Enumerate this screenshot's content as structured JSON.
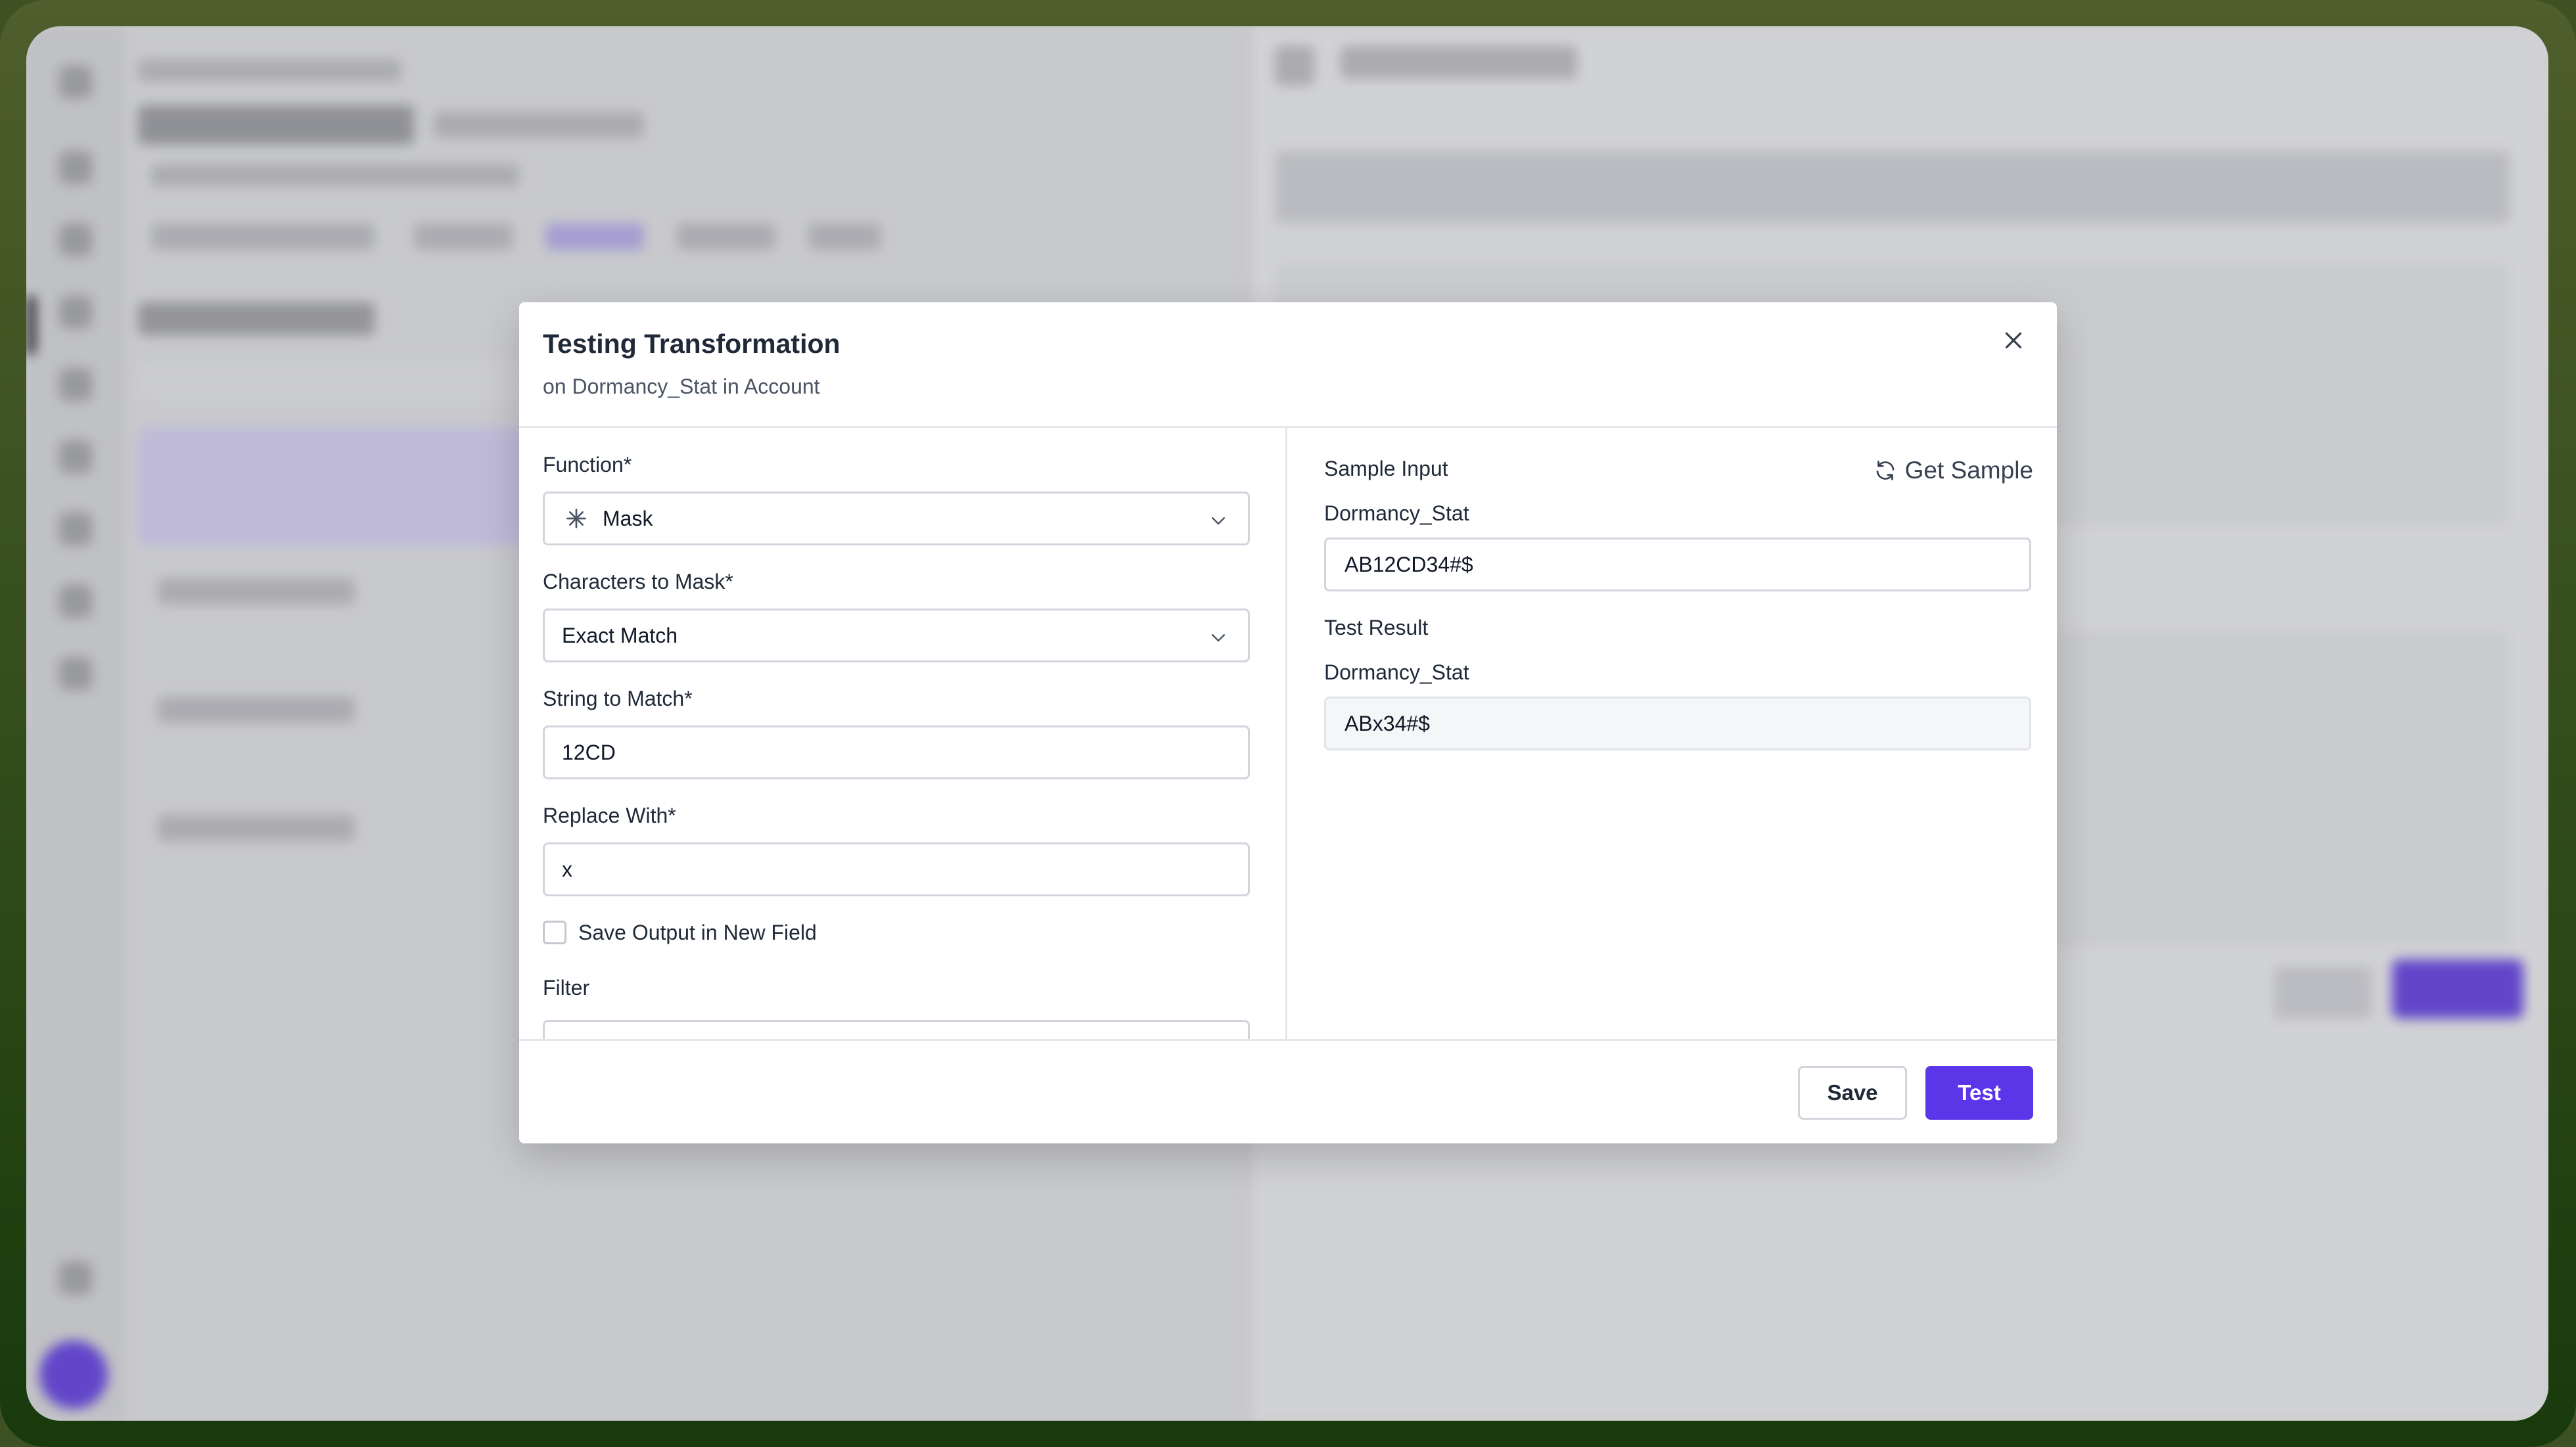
{
  "modal": {
    "title": "Testing Transformation",
    "subtitle": "on Dormancy_Stat in Account",
    "close_icon": "close-icon"
  },
  "form": {
    "function_label": "Function*",
    "function_value": "Mask",
    "function_icon": "asterisk-icon",
    "chars_label": "Characters to Mask*",
    "chars_value": "Exact Match",
    "string_label": "String to Match*",
    "string_value": "12CD",
    "replace_label": "Replace With*",
    "replace_value": "x",
    "save_output_label": "Save Output in New Field",
    "save_output_checked": false,
    "filter_label": "Filter"
  },
  "sample": {
    "section_label": "Sample Input",
    "get_sample_label": "Get Sample",
    "input_field_label": "Dormancy_Stat",
    "input_value": "AB12CD34#$",
    "result_section_label": "Test Result",
    "result_field_label": "Dormancy_Stat",
    "result_value": "ABx34#$"
  },
  "footer": {
    "save_label": "Save",
    "test_label": "Test"
  },
  "colors": {
    "primary": "#5b35e8",
    "border": "#d1d5db",
    "text": "#1f2937"
  }
}
